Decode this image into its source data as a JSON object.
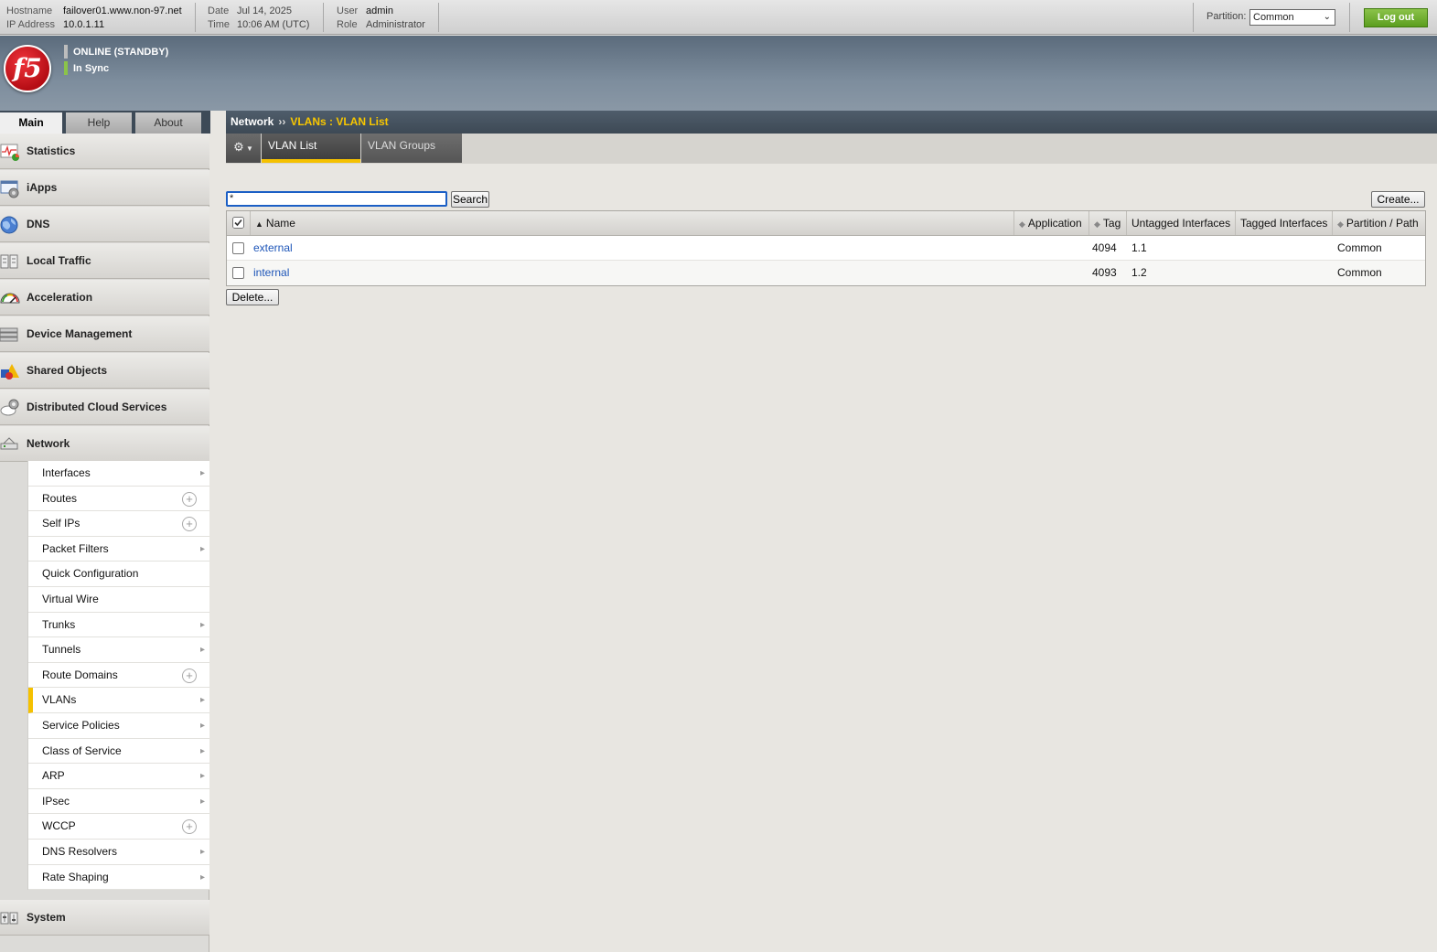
{
  "topbar": {
    "hostname_label": "Hostname",
    "hostname": "failover01.www.non-97.net",
    "ip_label": "IP Address",
    "ip": "10.0.1.11",
    "date_label": "Date",
    "date": "Jul 14, 2025",
    "time_label": "Time",
    "time": "10:06 AM (UTC)",
    "user_label": "User",
    "user": "admin",
    "role_label": "Role",
    "role": "Administrator",
    "partition_label": "Partition:",
    "partition_value": "Common",
    "logout_label": "Log out"
  },
  "banner": {
    "logo_text": "f5",
    "status_online": "ONLINE (STANDBY)",
    "status_sync": "In Sync",
    "online_color": "#bdbdbd",
    "sync_color": "#8bc34a"
  },
  "main_tabs": [
    {
      "label": "Main",
      "active": true
    },
    {
      "label": "Help",
      "active": false
    },
    {
      "label": "About",
      "active": false
    }
  ],
  "sidebar": {
    "sections": [
      {
        "label": "Statistics",
        "icon": "statistics-icon"
      },
      {
        "label": "iApps",
        "icon": "iapps-icon"
      },
      {
        "label": "DNS",
        "icon": "globe-icon"
      },
      {
        "label": "Local Traffic",
        "icon": "local-traffic-icon"
      },
      {
        "label": "Acceleration",
        "icon": "speedometer-icon"
      },
      {
        "label": "Device Management",
        "icon": "device-management-icon"
      },
      {
        "label": "Shared Objects",
        "icon": "shapes-icon"
      },
      {
        "label": "Distributed Cloud Services",
        "icon": "cloud-gear-icon"
      },
      {
        "label": "Network",
        "icon": "network-icon"
      }
    ],
    "network_items": [
      {
        "label": "Interfaces",
        "control": "arrow"
      },
      {
        "label": "Routes",
        "control": "plus"
      },
      {
        "label": "Self IPs",
        "control": "plus"
      },
      {
        "label": "Packet Filters",
        "control": "arrow"
      },
      {
        "label": "Quick Configuration",
        "control": "none"
      },
      {
        "label": "Virtual Wire",
        "control": "none"
      },
      {
        "label": "Trunks",
        "control": "arrow"
      },
      {
        "label": "Tunnels",
        "control": "arrow"
      },
      {
        "label": "Route Domains",
        "control": "plus"
      },
      {
        "label": "VLANs",
        "control": "arrow",
        "active": true
      },
      {
        "label": "Service Policies",
        "control": "arrow"
      },
      {
        "label": "Class of Service",
        "control": "arrow"
      },
      {
        "label": "ARP",
        "control": "arrow"
      },
      {
        "label": "IPsec",
        "control": "arrow"
      },
      {
        "label": "WCCP",
        "control": "plus"
      },
      {
        "label": "DNS Resolvers",
        "control": "arrow"
      },
      {
        "label": "Rate Shaping",
        "control": "arrow"
      }
    ],
    "system_label": "System"
  },
  "breadcrumb": {
    "root": "Network",
    "separator": "››",
    "current": "VLANs : VLAN List"
  },
  "subtabs": [
    {
      "label": "VLAN List",
      "active": true
    },
    {
      "label": "VLAN Groups",
      "active": false
    }
  ],
  "search": {
    "value": "*",
    "button_label": "Search"
  },
  "create_label": "Create...",
  "delete_label": "Delete...",
  "table": {
    "columns": [
      "Name",
      "Application",
      "Tag",
      "Untagged Interfaces",
      "Tagged Interfaces",
      "Partition / Path"
    ],
    "rows": [
      {
        "name": "external",
        "application": "",
        "tag": "4094",
        "untagged": "1.1",
        "tagged": "",
        "partition": "Common"
      },
      {
        "name": "internal",
        "application": "",
        "tag": "4093",
        "untagged": "1.2",
        "tagged": "",
        "partition": "Common"
      }
    ]
  },
  "colors": {
    "accent_yellow": "#f5c100",
    "link_blue": "#1d55b8",
    "logout_green": "#6aab2a"
  }
}
